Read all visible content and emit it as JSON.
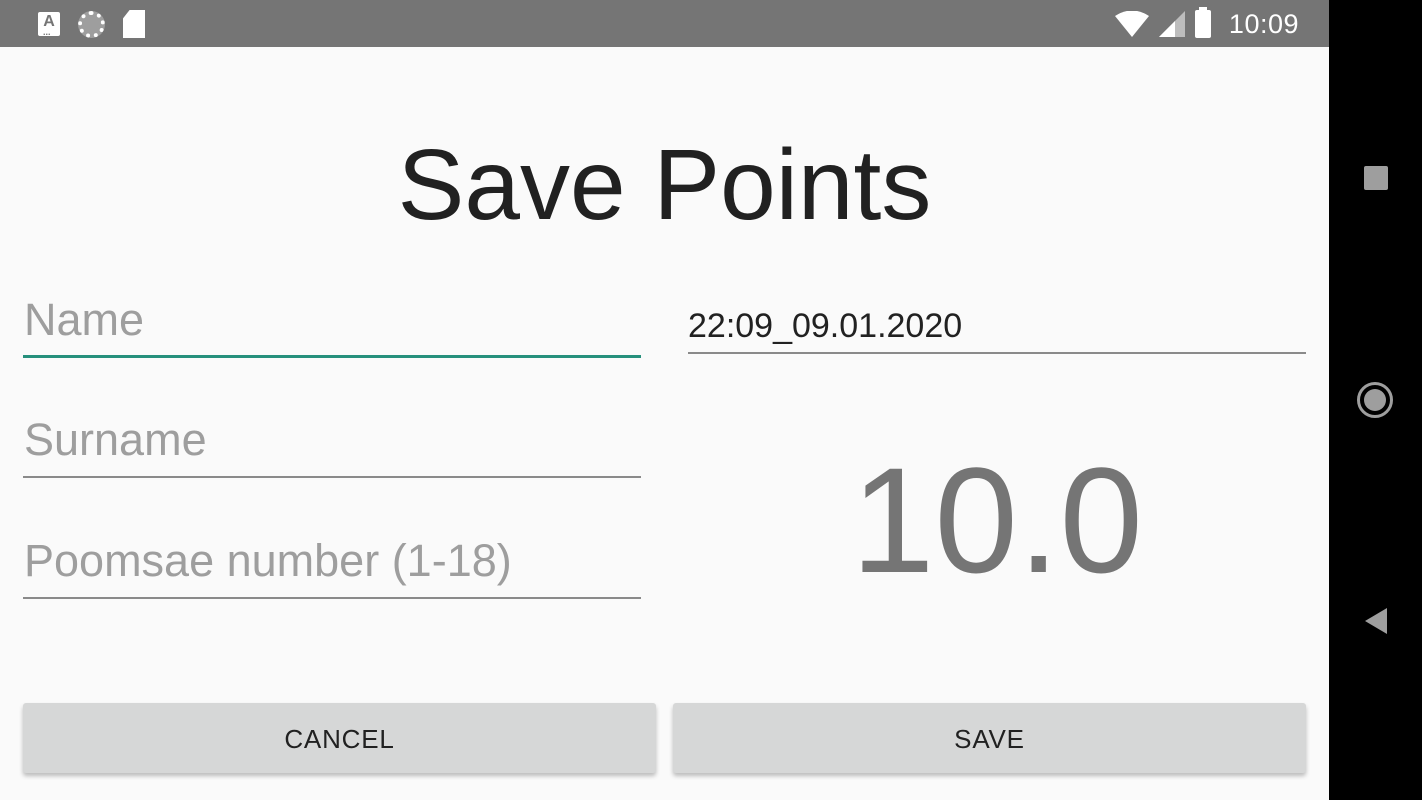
{
  "status_bar": {
    "time": "10:09",
    "left_icons": [
      "keyboard-a-icon",
      "loader-icon",
      "sd-card-icon"
    ],
    "right_icons": [
      "wifi-icon",
      "signal-icon",
      "battery-icon"
    ]
  },
  "page": {
    "title": "Save Points"
  },
  "form": {
    "name_placeholder": "Name",
    "surname_placeholder": "Surname",
    "poomsae_placeholder": "Poomsae number (1-18)",
    "datetime_value": "22:09_09.01.2020",
    "score": "10.0"
  },
  "buttons": {
    "cancel_label": "CANCEL",
    "save_label": "SAVE"
  },
  "nav_bar": {
    "icons": [
      "recents-icon",
      "home-icon",
      "back-icon"
    ]
  },
  "colors": {
    "accent": "#26907c",
    "status_bar": "#757575",
    "button_bg": "#d6d7d7",
    "score_text": "#757575"
  }
}
